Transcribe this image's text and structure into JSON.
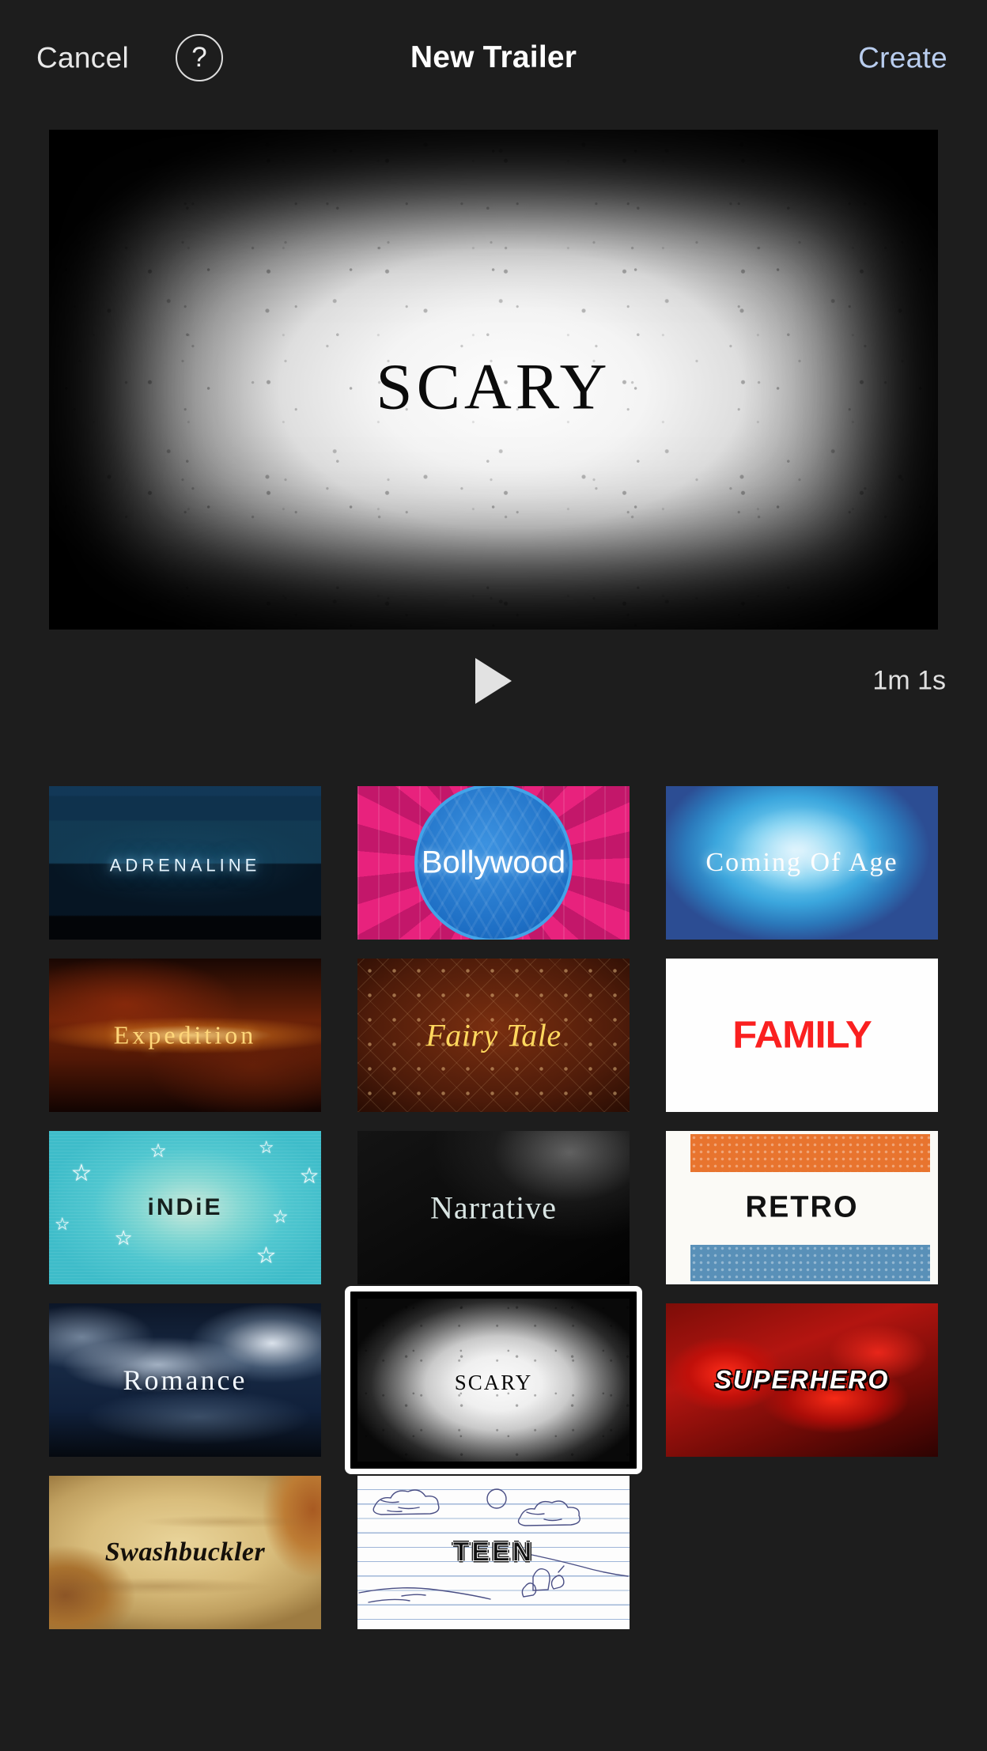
{
  "navbar": {
    "cancel_label": "Cancel",
    "help_glyph": "?",
    "title": "New Trailer",
    "create_label": "Create"
  },
  "preview": {
    "title": "Scary",
    "play_label": "Play",
    "duration": "1m 1s"
  },
  "grid": {
    "tiles": [
      {
        "id": "adrenaline",
        "label": "Adrenaline",
        "selected": false
      },
      {
        "id": "bollywood",
        "label": "Bollywood",
        "selected": false
      },
      {
        "id": "coming-of-age",
        "label": "Coming Of Age",
        "selected": false
      },
      {
        "id": "expedition",
        "label": "Expedition",
        "selected": false
      },
      {
        "id": "fairy-tale",
        "label": "Fairy Tale",
        "selected": false
      },
      {
        "id": "family",
        "label": "FAMILY",
        "selected": false
      },
      {
        "id": "indie",
        "label": "iNDiE",
        "selected": false
      },
      {
        "id": "narrative",
        "label": "Narrative",
        "selected": false
      },
      {
        "id": "retro",
        "label": "RETRO",
        "selected": false
      },
      {
        "id": "romance",
        "label": "Romance",
        "selected": false
      },
      {
        "id": "scary",
        "label": "Scary",
        "selected": true
      },
      {
        "id": "superhero",
        "label": "SUPERHERO",
        "selected": false
      },
      {
        "id": "swashbuckler",
        "label": "Swashbuckler",
        "selected": false
      },
      {
        "id": "teen",
        "label": "TEEN",
        "selected": false
      }
    ]
  },
  "colors": {
    "background": "#1d1d1d",
    "accent": "#b9cdee",
    "text_primary": "#ffffff",
    "selection_border": "#ffffff",
    "family_red": "#fa2020",
    "retro_orange": "#e8742e",
    "retro_blue": "#5990b8",
    "bollywood_blue": "#2f86d8",
    "expedition_gold": "#ffd77a",
    "fairytale_gold": "#ffd85e"
  }
}
